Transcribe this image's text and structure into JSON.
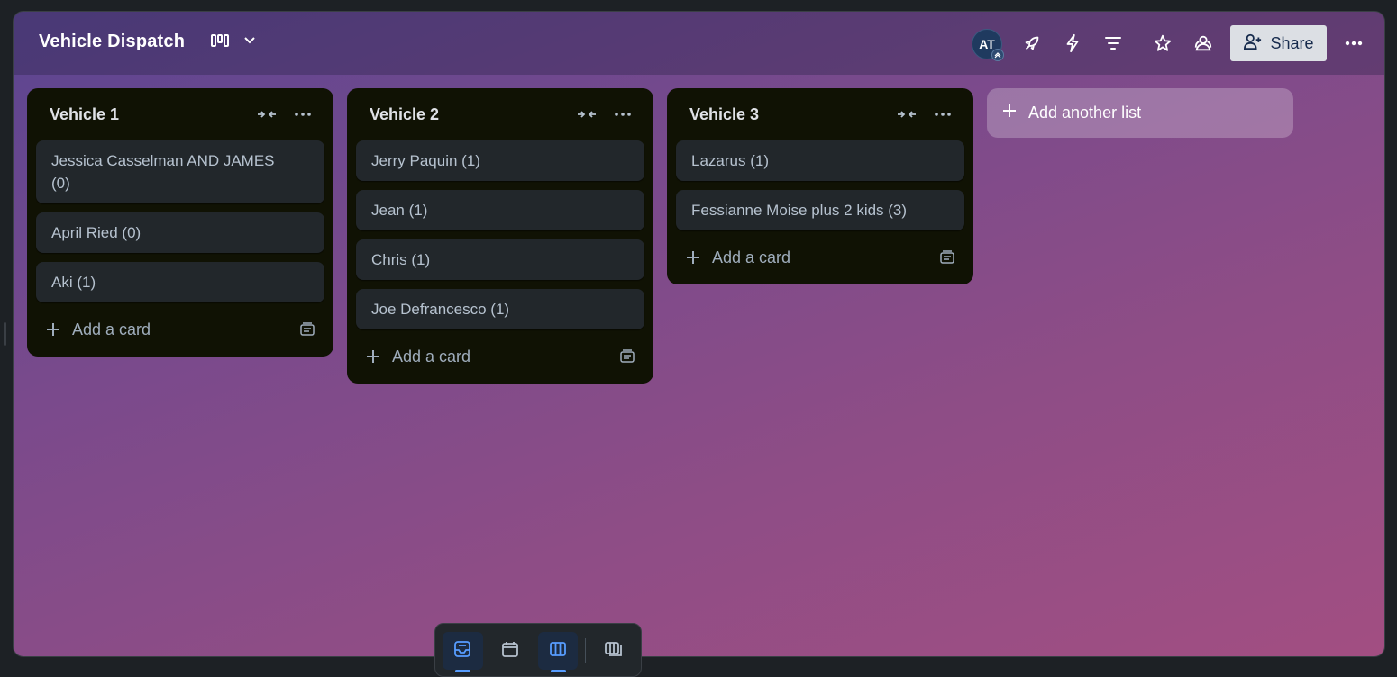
{
  "board": {
    "title": "Vehicle Dispatch"
  },
  "header": {
    "avatar_initials": "AT",
    "share_label": "Share"
  },
  "lists": [
    {
      "title": "Vehicle 1",
      "cards": [
        "Jessica Casselman AND JAMES (0)",
        "April Ried (0)",
        "Aki (1)"
      ],
      "add_card_label": "Add a card"
    },
    {
      "title": "Vehicle 2",
      "cards": [
        "Jerry Paquin (1)",
        "Jean (1)",
        "Chris (1)",
        "Joe Defrancesco (1)"
      ],
      "add_card_label": "Add a card"
    },
    {
      "title": "Vehicle 3",
      "cards": [
        "Lazarus (1)",
        "Fessianne Moise plus 2 kids (3)"
      ],
      "add_card_label": "Add a card"
    }
  ],
  "add_list_label": "Add another list",
  "bottom_bar": {
    "items": [
      "inbox-icon",
      "calendar-icon",
      "board-icon",
      "switch-boards-icon"
    ],
    "active": [
      "inbox-icon",
      "board-icon"
    ]
  },
  "colors": {
    "accent": "#579dff",
    "list_bg": "#101204",
    "card_bg": "#22272b"
  }
}
